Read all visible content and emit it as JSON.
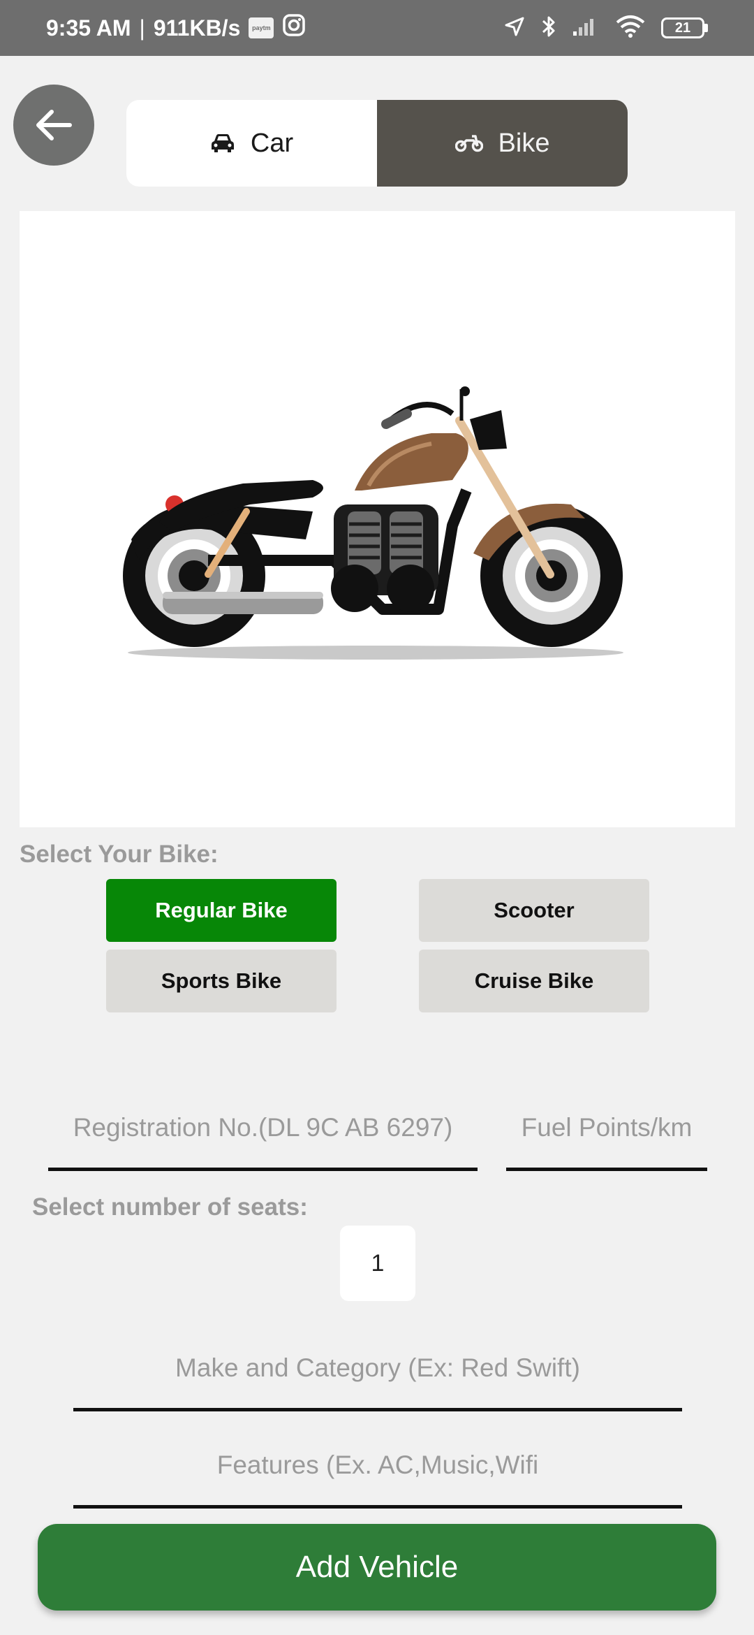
{
  "status_bar": {
    "time": "9:35 AM",
    "network_speed": "911KB/s",
    "paytm_label": "paytm",
    "battery": "21"
  },
  "toggle": {
    "car_label": "Car",
    "bike_label": "Bike",
    "selected": "Bike"
  },
  "bike_section": {
    "label": "Select Your Bike:",
    "options": [
      "Regular Bike",
      "Scooter",
      "Sports Bike",
      "Cruise Bike"
    ],
    "selected": "Regular Bike"
  },
  "registration": {
    "placeholder": "Registration No.(DL 9C AB 6297)",
    "value": ""
  },
  "fuel": {
    "placeholder": "Fuel Points/km",
    "value": ""
  },
  "seats": {
    "label": "Select number of seats:",
    "value": "1"
  },
  "make": {
    "placeholder": "Make and Category (Ex: Red Swift)",
    "value": ""
  },
  "features": {
    "placeholder": "Features (Ex. AC,Music,Wifi",
    "value": ""
  },
  "add_button_label": "Add Vehicle",
  "colors": {
    "status_bar": "#6e6e6e",
    "selected_green": "#078707",
    "add_button": "#2e7d38",
    "bike_tab": "#55524c"
  },
  "icons": {
    "back": "arrow-left-icon",
    "car": "car-icon",
    "bike": "bike-icon"
  }
}
